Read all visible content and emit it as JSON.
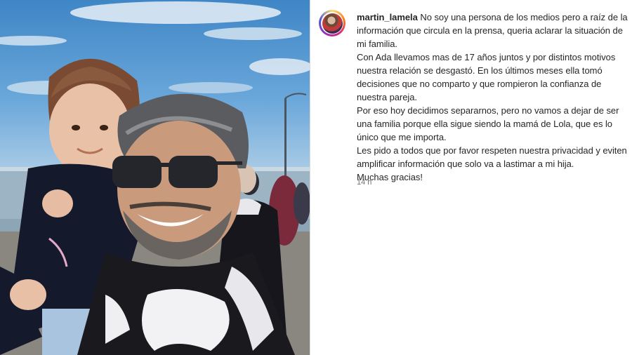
{
  "post": {
    "photo_alt": "Foto de padre e hija",
    "author": {
      "username": "martin_lamela"
    },
    "caption": {
      "first": "No soy una persona de los medios pero a raíz de la información que circula en la prensa, queria aclarar la situación de mi familia.",
      "paragraphs": [
        "Con Ada llevamos mas de 17 años juntos y por distintos motivos nuestra relación se desgastó. En los últimos meses ella tomó decisiones que no comparto y que rompieron la confianza de nuestra pareja.",
        "Por eso hoy decidimos separarnos, pero no vamos a dejar de ser una familia porque ella sigue siendo la mamá de Lola, que es lo único que me importa.",
        "Les pido a todos que por favor respeten nuestra privacidad y eviten amplificar información que solo va a lastimar a mi hija.",
        "Muchas gracias!"
      ]
    },
    "timestamp": "14 h"
  },
  "colors": {
    "text": "#262626",
    "secondary_text": "#737373",
    "divider": "#dbdbdb"
  }
}
